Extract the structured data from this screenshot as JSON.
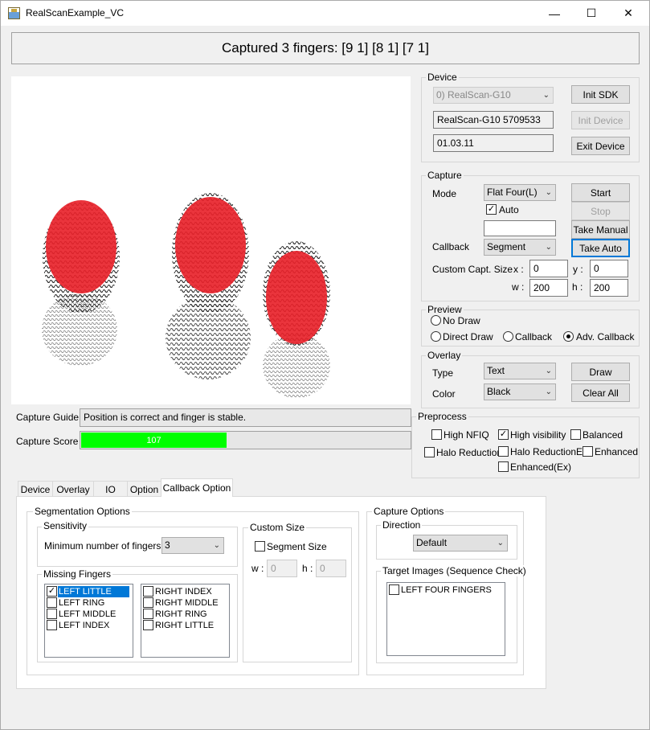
{
  "window": {
    "title": "RealScanExample_VC",
    "minimize": "—",
    "maximize": "☐",
    "close": "✕"
  },
  "banner": "Captured 3 fingers: [9 1] [8 1] [7 1]",
  "device": {
    "group": "Device",
    "combo": "0) RealScan-G10",
    "model": "RealScan-G10 5709533",
    "version": "01.03.11",
    "init_sdk": "Init SDK",
    "init_device": "Init Device",
    "exit_device": "Exit Device"
  },
  "capture": {
    "group": "Capture",
    "mode_label": "Mode",
    "mode_value": "Flat Four(L)",
    "auto_label": "Auto",
    "auto_checked": true,
    "callback_label": "Callback",
    "callback_value": "Segment",
    "custom_size_label": "Custom Capt. Size",
    "x_label": "x :",
    "x_value": "0",
    "y_label": "y :",
    "y_value": "0",
    "w_label": "w :",
    "w_value": "200",
    "h_label": "h :",
    "h_value": "200",
    "start": "Start",
    "stop": "Stop",
    "take_manual": "Take Manual",
    "take_auto": "Take Auto"
  },
  "preview": {
    "group": "Preview",
    "no_draw": "No Draw",
    "direct_draw": "Direct Draw",
    "callback": "Callback",
    "adv_callback": "Adv. Callback",
    "selected": "adv_callback"
  },
  "overlay": {
    "group": "Overlay",
    "type_label": "Type",
    "type_value": "Text",
    "color_label": "Color",
    "color_value": "Black",
    "draw": "Draw",
    "clear_all": "Clear All"
  },
  "preprocess": {
    "group": "Preprocess",
    "high_nfiq": "High NFIQ",
    "high_visibility": "High visibility",
    "balanced": "Balanced",
    "halo_reduction": "Halo Reduction",
    "halo_reduction_ex": "Halo ReductionEx",
    "enhanced": "Enhanced",
    "enhanced_ex": "Enhanced(Ex)",
    "high_visibility_checked": true
  },
  "status": {
    "guide_label": "Capture Guide :",
    "guide_text": "Position is correct and finger is stable.",
    "score_label": "Capture Score :",
    "score_value": "107",
    "score_fraction": 0.44,
    "score_color": "#00ff00"
  },
  "tabs": [
    "Device",
    "Overlay",
    "IO",
    "Option",
    "Callback Option"
  ],
  "active_tab": "Callback Option",
  "seg": {
    "group": "Segmentation Options",
    "sensitivity_group": "Sensitivity",
    "min_fingers_label": "Minimum number of fingers :",
    "min_fingers_value": "3",
    "custom_size_group": "Custom Size",
    "segment_size_label": "Segment Size",
    "w_label": "w :",
    "w_value": "0",
    "h_label": "h :",
    "h_value": "0",
    "missing_group": "Missing Fingers",
    "left_list": [
      "LEFT LITTLE",
      "LEFT RING",
      "LEFT MIDDLE",
      "LEFT INDEX"
    ],
    "right_list": [
      "RIGHT INDEX",
      "RIGHT MIDDLE",
      "RIGHT RING",
      "RIGHT LITTLE"
    ]
  },
  "capopt": {
    "group": "Capture Options",
    "direction_group": "Direction",
    "direction_value": "Default",
    "target_group": "Target Images (Sequence Check)",
    "target_list": [
      "LEFT FOUR FINGERS"
    ]
  },
  "colors": {
    "finger_overlay": "#e8232b",
    "accent": "#0078d7"
  }
}
